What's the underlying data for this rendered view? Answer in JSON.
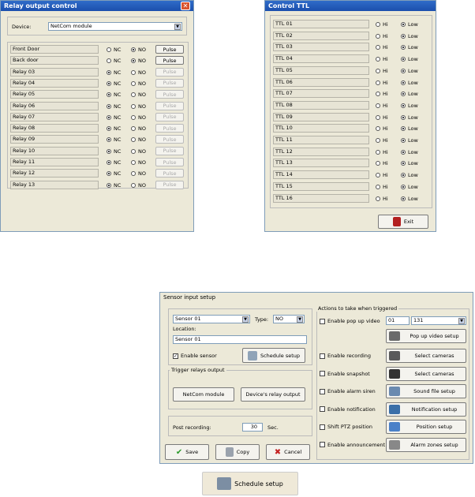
{
  "relay": {
    "title": "Relay output control",
    "device_label": "Device:",
    "device_value": "NetCom module",
    "nc_label": "NC",
    "no_label": "NO",
    "rows": [
      {
        "name": "Front Door",
        "sel": "NO",
        "pulse": "Pulse",
        "enabled": true
      },
      {
        "name": "Back door",
        "sel": "NO",
        "pulse": "Pulse",
        "enabled": true
      },
      {
        "name": "Relay 03",
        "sel": "NC",
        "pulse": "Pulse",
        "enabled": false
      },
      {
        "name": "Relay 04",
        "sel": "NC",
        "pulse": "Pulse",
        "enabled": false
      },
      {
        "name": "Relay 05",
        "sel": "NC",
        "pulse": "Pulse",
        "enabled": false
      },
      {
        "name": "Relay 06",
        "sel": "NC",
        "pulse": "Pulse",
        "enabled": false
      },
      {
        "name": "Relay 07",
        "sel": "NC",
        "pulse": "Pulse",
        "enabled": false
      },
      {
        "name": "Relay 08",
        "sel": "NC",
        "pulse": "Pulse",
        "enabled": false
      },
      {
        "name": "Relay 09",
        "sel": "NC",
        "pulse": "Pulse",
        "enabled": false
      },
      {
        "name": "Relay 10",
        "sel": "NC",
        "pulse": "Pulse",
        "enabled": false
      },
      {
        "name": "Relay 11",
        "sel": "NC",
        "pulse": "Pulse",
        "enabled": false
      },
      {
        "name": "Relay 12",
        "sel": "NC",
        "pulse": "Pulse",
        "enabled": false
      },
      {
        "name": "Relay 13",
        "sel": "NC",
        "pulse": "Pulse",
        "enabled": false
      }
    ]
  },
  "ttl": {
    "title": "Control TTL",
    "hi_label": "Hi",
    "low_label": "Low",
    "rows": [
      "TTL 01",
      "TTL 02",
      "TTL 03",
      "TTL 04",
      "TTL 05",
      "TTL 06",
      "TTL 07",
      "TTL 08",
      "TTL 09",
      "TTL 10",
      "TTL 11",
      "TTL 12",
      "TTL 13",
      "TTL 14",
      "TTL 15",
      "TTL 16"
    ],
    "exit_label": "Exit"
  },
  "sensor": {
    "title": "Sensor input setup",
    "sensor_value": "Sensor 01",
    "type_label": "Type:",
    "type_value": "NO",
    "location_label": "Location:",
    "location_value": "Sensor 01",
    "enable_sensor": "Enable sensor",
    "schedule_btn": "Schedule setup",
    "trigger_group": "Trigger relays output",
    "netcom_btn": "NetCom module",
    "device_relay_btn": "Device's relay output",
    "post_label": "Post recording:",
    "post_value": "30",
    "post_unit": "Sec.",
    "save": "Save",
    "copy": "Copy",
    "cancel": "Cancel",
    "actions_group": "Actions to take when triggered",
    "popup_label": "Enable pop up video",
    "cam_value": "01",
    "cam_num": "131",
    "popup_setup": "Pop up video setup",
    "rec_label": "Enable recording",
    "rec_btn": "Select cameras",
    "snap_label": "Enable snapshot",
    "snap_btn": "Select cameras",
    "alarm_label": "Enable alarm siren",
    "alarm_btn": "Sound file setup",
    "notif_label": "Enable notification",
    "notif_btn": "Notification setup",
    "ptz_label": "Shift PTZ position",
    "ptz_btn": "Position setup",
    "ann_label": "Enable announcement",
    "ann_btn": "Alarm zones setup"
  },
  "bottom": {
    "schedule_label": "Schedule setup"
  }
}
